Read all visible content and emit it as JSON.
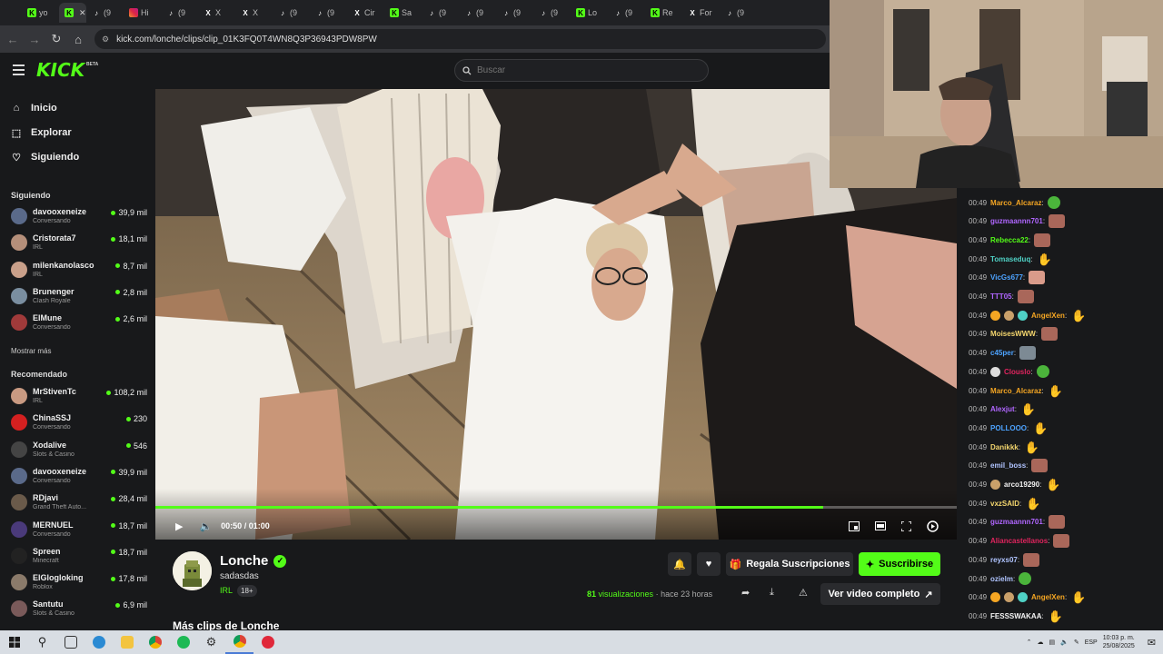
{
  "browser": {
    "tabs": [
      {
        "label": "yo",
        "icon": "kick"
      },
      {
        "label": "",
        "icon": "kick",
        "active": true
      },
      {
        "label": "(9",
        "icon": "tiktok"
      },
      {
        "label": "Hi",
        "icon": "instagram"
      },
      {
        "label": "(9",
        "icon": "tiktok"
      },
      {
        "label": "X",
        "icon": "x"
      },
      {
        "label": "X",
        "icon": "x"
      },
      {
        "label": "(9",
        "icon": "tiktok"
      },
      {
        "label": "(9",
        "icon": "tiktok"
      },
      {
        "label": "Cir",
        "icon": "x"
      },
      {
        "label": "Sa",
        "icon": "kick"
      },
      {
        "label": "(9",
        "icon": "tiktok"
      },
      {
        "label": "(9",
        "icon": "tiktok"
      },
      {
        "label": "(9",
        "icon": "tiktok"
      },
      {
        "label": "(9",
        "icon": "tiktok"
      },
      {
        "label": "Lo",
        "icon": "kick"
      },
      {
        "label": "(9",
        "icon": "tiktok"
      },
      {
        "label": "Re",
        "icon": "kick"
      },
      {
        "label": "For",
        "icon": "x"
      },
      {
        "label": "(9",
        "icon": "tiktok"
      }
    ],
    "url": "kick.com/lonche/clips/clip_01K3FQ0T4WN8Q3P36943PDW8PW"
  },
  "header": {
    "logo": "KICK",
    "beta": "BETA",
    "search_placeholder": "Buscar"
  },
  "sidebar": {
    "nav": [
      {
        "label": "Inicio",
        "icon": "home-icon"
      },
      {
        "label": "Explorar",
        "icon": "compass-icon"
      },
      {
        "label": "Siguiendo",
        "icon": "heart-icon"
      }
    ],
    "following_title": "Siguiendo",
    "following": [
      {
        "name": "davooxeneize",
        "category": "Conversando",
        "viewers": "39,9 mil",
        "color": "#5a6a8a"
      },
      {
        "name": "Cristorata7",
        "category": "IRL",
        "viewers": "18,1 mil",
        "color": "#b58f7a"
      },
      {
        "name": "milenkanolasco",
        "category": "IRL",
        "viewers": "8,7 mil",
        "color": "#c9a08a"
      },
      {
        "name": "Brunenger",
        "category": "Clash Royale",
        "viewers": "2,8 mil",
        "color": "#7a8ea0"
      },
      {
        "name": "ElMune",
        "category": "Conversando",
        "viewers": "2,6 mil",
        "color": "#a03a3a"
      }
    ],
    "show_more": "Mostrar más",
    "recommended_title": "Recomendado",
    "recommended": [
      {
        "name": "MrStivenTc",
        "category": "IRL",
        "viewers": "108,2 mil",
        "color": "#c99a82"
      },
      {
        "name": "ChinaSSJ",
        "category": "Conversando",
        "viewers": "230",
        "color": "#d42020"
      },
      {
        "name": "Xodalive",
        "category": "Slots & Casino",
        "viewers": "546",
        "color": "#444"
      },
      {
        "name": "davooxeneize",
        "category": "Conversando",
        "viewers": "39,9 mil",
        "color": "#5a6a8a"
      },
      {
        "name": "RDjavi",
        "category": "Grand Theft Auto...",
        "viewers": "28,4 mil",
        "color": "#6a5a4a"
      },
      {
        "name": "MERNUEL",
        "category": "Conversando",
        "viewers": "18,7 mil",
        "color": "#4a3a7a"
      },
      {
        "name": "Spreen",
        "category": "Minecraft",
        "viewers": "18,7 mil",
        "color": "#222"
      },
      {
        "name": "ElGlogloking",
        "category": "Roblox",
        "viewers": "17,8 mil",
        "color": "#8a7a6a"
      },
      {
        "name": "Santutu",
        "category": "Slots & Casino",
        "viewers": "6,9 mil",
        "color": "#7a5a5a"
      }
    ]
  },
  "player": {
    "progress": 0.833,
    "time": "00:50 / 01:00"
  },
  "clip": {
    "channel": "Lonche",
    "title": "sadasdas",
    "category": "IRL",
    "age": "18+",
    "gift_label": "Regala Suscripciones",
    "subscribe_label": "Suscribirse",
    "views_count": "81",
    "views_label": "visualizaciones",
    "time_ago": "hace 23 horas",
    "full_video_label": "Ver video completo",
    "more_clips": "Más clips de Lonche"
  },
  "chat": [
    {
      "time": "00:49",
      "user": "Marco_Alcaraz",
      "color": "#f5a623",
      "emote": "green",
      "badges": []
    },
    {
      "time": "00:49",
      "user": "guzmaannn701",
      "color": "#b066ff",
      "emote": "face",
      "badges": []
    },
    {
      "time": "00:49",
      "user": "Rebecca22",
      "color": "#53fc18",
      "emote": "face",
      "badges": []
    },
    {
      "time": "00:49",
      "user": "Tomaseduq",
      "color": "#4fd1c5",
      "emote": "teal",
      "badges": []
    },
    {
      "time": "00:49",
      "user": "VicGs677",
      "color": "#4da3ff",
      "emote": "hand",
      "badges": []
    },
    {
      "time": "00:49",
      "user": "TTT05",
      "color": "#b066ff",
      "emote": "face",
      "badges": []
    },
    {
      "time": "00:49",
      "user": "AngelXen",
      "color": "#f5a623",
      "emote": "teal",
      "badges": [
        "#f5a623",
        "#c9a06a",
        "#4fd1c5"
      ]
    },
    {
      "time": "00:49",
      "user": "MoisesWWW",
      "color": "#f5d76e",
      "emote": "face",
      "badges": []
    },
    {
      "time": "00:49",
      "user": "c45per",
      "color": "#4da3ff",
      "emote": "cat",
      "badges": []
    },
    {
      "time": "00:49",
      "user": "Clouslo",
      "color": "#e0245e",
      "emote": "green",
      "badges": [
        "#ddd"
      ]
    },
    {
      "time": "00:49",
      "user": "Marco_Alcaraz",
      "color": "#f5a623",
      "emote": "teal",
      "badges": []
    },
    {
      "time": "00:49",
      "user": "Alexjut",
      "color": "#b066ff",
      "emote": "teal",
      "badges": []
    },
    {
      "time": "00:49",
      "user": "POLLOOO",
      "color": "#4da3ff",
      "emote": "teal",
      "badges": []
    },
    {
      "time": "00:49",
      "user": "Danikkk",
      "color": "#f5d76e",
      "emote": "teal",
      "badges": []
    },
    {
      "time": "00:49",
      "user": "emil_boss",
      "color": "#b0c4ff",
      "emote": "face",
      "badges": []
    },
    {
      "time": "00:49",
      "user": "arco19290",
      "color": "#f5f5f5",
      "emote": "teal",
      "badges": [
        "#c9a06a"
      ]
    },
    {
      "time": "00:49",
      "user": "vxzSAID",
      "color": "#f5d76e",
      "emote": "teal",
      "badges": []
    },
    {
      "time": "00:49",
      "user": "guzmaannn701",
      "color": "#b066ff",
      "emote": "face",
      "badges": []
    },
    {
      "time": "00:49",
      "user": "Aliancastellanos",
      "color": "#e0245e",
      "emote": "face",
      "badges": []
    },
    {
      "time": "00:49",
      "user": "reyxs07",
      "color": "#b0c4ff",
      "emote": "face",
      "badges": []
    },
    {
      "time": "00:49",
      "user": "ozielm",
      "color": "#b0c4ff",
      "emote": "green",
      "badges": []
    },
    {
      "time": "00:49",
      "user": "AngelXen",
      "color": "#f5a623",
      "emote": "teal",
      "badges": [
        "#f5a623",
        "#c9a06a",
        "#4fd1c5"
      ]
    },
    {
      "time": "00:49",
      "user": "FESSSWAKAA",
      "color": "#f5f5f5",
      "emote": "teal",
      "badges": []
    }
  ],
  "taskbar": {
    "lang": "ESP",
    "time": "10:03 p. m.",
    "date": "25/08/2025"
  }
}
